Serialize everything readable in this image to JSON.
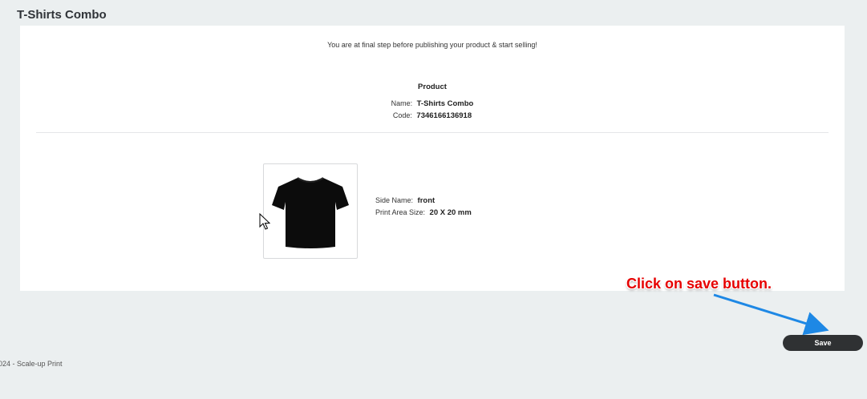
{
  "page": {
    "title": "T-Shirts Combo"
  },
  "summary": {
    "intro": "You are at final step before publishing your product & start selling!",
    "product_heading": "Product",
    "name_label": "Name:",
    "name_value": "T-Shirts Combo",
    "code_label": "Code:",
    "code_value": "7346166136918"
  },
  "side": {
    "name_label": "Side Name:",
    "name_value": "front",
    "print_area_label": "Print Area Size:",
    "print_area_value": "20 X 20 mm",
    "image_icon": "tshirt-image"
  },
  "annotation": {
    "callout": "Click on save button.",
    "arrow_color": "#1e88e5",
    "callout_color": "#e60000"
  },
  "actions": {
    "save_label": "Save"
  },
  "footer": {
    "text": "024 - Scale-up Print"
  }
}
